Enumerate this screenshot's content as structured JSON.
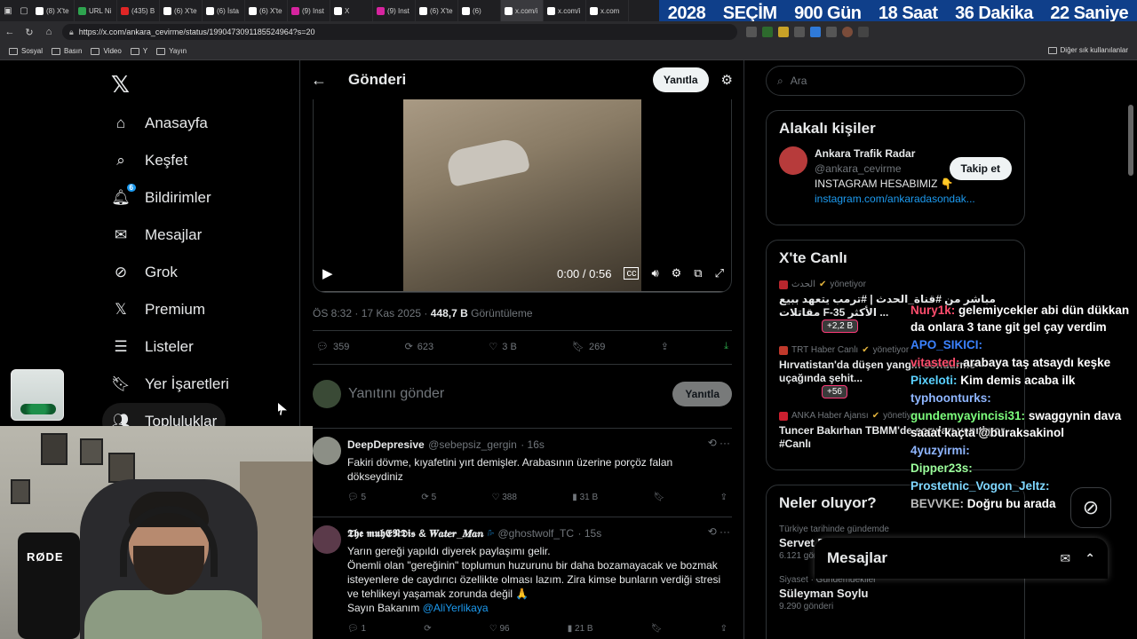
{
  "browser": {
    "tabs": [
      {
        "label": "(8) X'te",
        "icon": "x-icon"
      },
      {
        "label": "URL Ni",
        "icon": "url-icon"
      },
      {
        "label": "(435) B",
        "icon": "youtube-icon"
      },
      {
        "label": "(6) X'te",
        "icon": "x-icon"
      },
      {
        "label": "(6) İsta",
        "icon": "x-icon"
      },
      {
        "label": "(6) X'te",
        "icon": "x-icon"
      },
      {
        "label": "(9) Inst",
        "icon": "instagram-icon"
      },
      {
        "label": "X",
        "icon": "x-icon"
      },
      {
        "label": "(9) Inst",
        "icon": "instagram-icon"
      },
      {
        "label": "(6) X'te",
        "icon": "x-icon"
      },
      {
        "label": "(6)",
        "icon": "x-icon"
      },
      {
        "label": "x.com/i",
        "icon": "x-icon"
      },
      {
        "label": "x.com/i",
        "icon": "x-icon"
      },
      {
        "label": "x.com",
        "icon": "x-icon"
      }
    ],
    "url": "https://x.com/ankara_cevirme/status/1990473091185524964?s=20",
    "bookmarks": [
      "Sosyal",
      "Basın",
      "Video",
      "Y",
      "Yayın"
    ],
    "bookmarks_right": "Diğer sık kullanılanlar"
  },
  "banner": {
    "year": "2028",
    "label": "SEÇİM",
    "days": "900 Gün",
    "hours": "18 Saat",
    "minutes": "36 Dakika",
    "seconds": "22 Saniye"
  },
  "sidebar": {
    "items": [
      {
        "label": "Anasayfa",
        "icon": "home-icon"
      },
      {
        "label": "Keşfet",
        "icon": "search-icon"
      },
      {
        "label": "Bildirimler",
        "icon": "bell-icon",
        "badge": "6"
      },
      {
        "label": "Mesajlar",
        "icon": "mail-icon"
      },
      {
        "label": "Grok",
        "icon": "grok-icon"
      },
      {
        "label": "Premium",
        "icon": "x-premium-icon"
      },
      {
        "label": "Listeler",
        "icon": "list-icon"
      },
      {
        "label": "Yer İşaretleri",
        "icon": "bookmark-icon"
      },
      {
        "label": "Topluluklar",
        "icon": "communities-icon"
      }
    ]
  },
  "main": {
    "title": "Gönderi",
    "reply_button": "Yanıtla",
    "video": {
      "time": "0:00 / 0:56"
    },
    "meta": {
      "time": "ÖS 8:32",
      "date": "17 Kas 2025",
      "views": "448,7 B",
      "views_label": "Görüntüleme"
    },
    "actions": {
      "replies": "359",
      "reposts": "623",
      "likes": "3 B",
      "bookmarks": "269"
    },
    "reply_placeholder": "Yanıtını gönder",
    "reply_submit": "Yanıtla",
    "posts": [
      {
        "name": "DeepDepresive",
        "handle": "@sebepsiz_gergin",
        "time": "16s",
        "text": "Fakiri dövme, kıyafetini yırt demişler. Arabasının üzerine porçöz falan dökseydiniz",
        "replies": "5",
        "reposts": "5",
        "likes": "388",
        "views": "31 B"
      },
      {
        "name": "𝕿𝖍𝖊 𝖒𝖚𝖍𝕰𝕹𝕯𝖎𝖘 & 𝑾𝒂𝒕𝒆𝒓_𝑴𝒂𝒏",
        "handle": "@ghostwolf_TC",
        "time": "15s",
        "text1": "Yarın gereği yapıldı diyerek paylaşımı gelir.",
        "text2": "Önemli olan \"gereğinin\" toplumun huzurunu bir daha bozamayacak ve bozmak isteyenlere de caydırıcı özellikte olması lazım. Zira kimse bunların verdiği stresi ve tehlikeyi yaşamak zorunda değil 🙏",
        "text3": "Sayın Bakanım",
        "mention": "@AliYerlikaya",
        "replies": "1",
        "likes": "96",
        "views": "21 B"
      }
    ]
  },
  "right": {
    "search_placeholder": "Ara",
    "related": {
      "title": "Alakalı kişiler",
      "name": "Ankara Trafik Radar",
      "handle": "@ankara_cevirme",
      "follow": "Takip et",
      "bio": "INSTAGRAM HESABIMIZ 👇",
      "link": "instagram.com/ankaradasondak..."
    },
    "live": {
      "title": "X'te Canlı",
      "items": [
        {
          "source": "الحدث",
          "status": "yönetiyor",
          "title": "مباشر من #قناة_الحدث | #ترمب يتعهد ببيع مقاتلات F-35 الأكثر ...",
          "count": "+2,2 B"
        },
        {
          "source": "TRT Haber Canlı",
          "status": "yönetiyor",
          "title": "Hırvatistan'da düşen yangın söndürme uçağında şehit...",
          "count": "+56"
        },
        {
          "source": "ANKA Haber Ajansı",
          "status": "yönetiyor",
          "title": "Tuncer Bakırhan TBMM'de soruları yanıtlıyor #Canlı"
        }
      ]
    },
    "trends": {
      "title": "Neler oluyor?",
      "items": [
        {
          "category": "Türkiye tarihinde gündemde",
          "name": "Servet Böcek",
          "count": "6.121 gönderi"
        },
        {
          "category": "Siyaset · Gündemdekiler",
          "name": "Süleyman Soylu",
          "count": "9.290 gönderi"
        }
      ]
    },
    "messages": "Mesajlar"
  },
  "chat": [
    {
      "user": "Nury1k:",
      "color": "#ff4d6d",
      "msg": "gelemiycekler abi dün dükkan da onlara 3 tane git gel çay verdim"
    },
    {
      "user": "APO_SIKICI:",
      "color": "#3b82ff",
      "msg": ""
    },
    {
      "user": "vitasted:",
      "color": "#ff4d6d",
      "msg": "arabaya taş atsaydı keşke"
    },
    {
      "user": "Pixeloti:",
      "color": "#5ad1ff",
      "msg": "Kim demis acaba ilk"
    },
    {
      "user": "typhoonturks:",
      "color": "#8fb6ff",
      "msg": ""
    },
    {
      "user": "gundemyayincisi31:",
      "color": "#7dff7d",
      "msg": "swaggynin dava saaat kaçta @buraksakinol"
    },
    {
      "user": "4yuzyirmi:",
      "color": "#8fb6ff",
      "msg": ""
    },
    {
      "user": "Dipper23s:",
      "color": "#9cff9c",
      "msg": ""
    },
    {
      "user": "Prostetnic_Vogon_Jeltz:",
      "color": "#7fd7ff",
      "msg": ""
    },
    {
      "user": "BEVVKE:",
      "color": "#bbbbbb",
      "msg": "Doğru bu arada"
    }
  ],
  "cam": {
    "brand": "RØDE"
  }
}
